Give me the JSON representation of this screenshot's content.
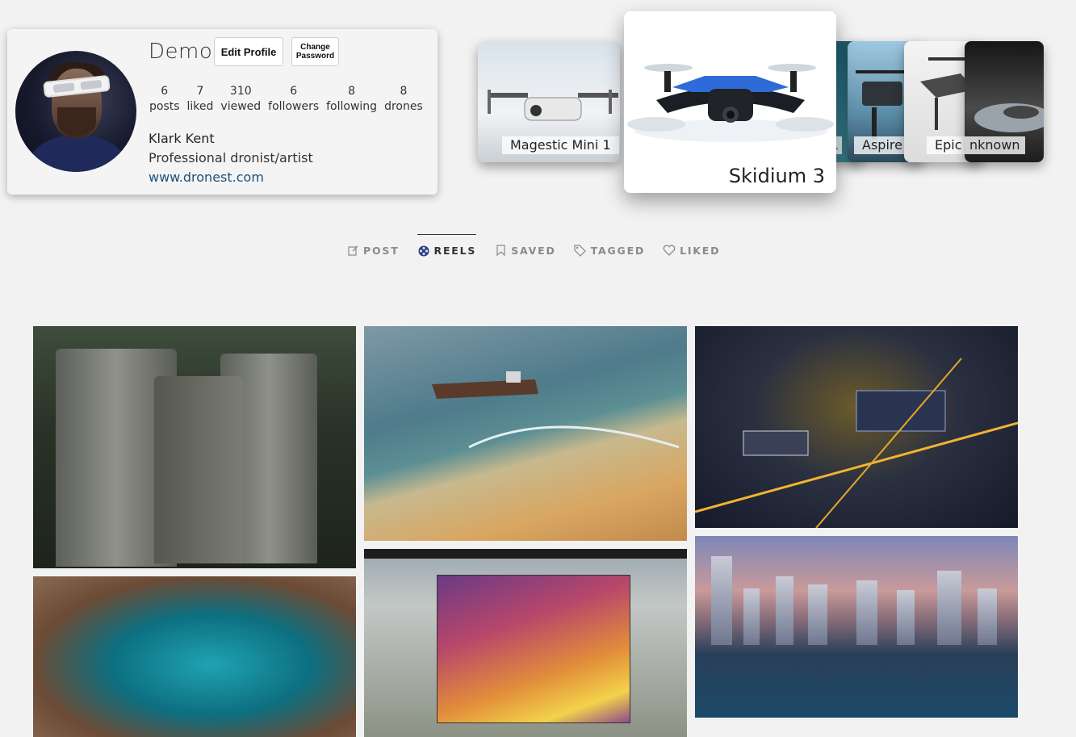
{
  "profile": {
    "username": "Demo",
    "edit_profile_label": "Edit Profile",
    "change_password_label": "Change\nPassword",
    "real_name": "Klark Kent",
    "bio": "Professional dronist/artist",
    "website": "www.dronest.com",
    "stats": [
      {
        "value": "6",
        "label": "posts"
      },
      {
        "value": "7",
        "label": "liked"
      },
      {
        "value": "310",
        "label": "viewed"
      },
      {
        "value": "6",
        "label": "followers"
      },
      {
        "value": "8",
        "label": "following"
      },
      {
        "value": "8",
        "label": "drones"
      }
    ]
  },
  "drones": {
    "featured": "Skidium 3",
    "cards": [
      {
        "label": "Magestic Mini 1"
      },
      {
        "label": "e 1"
      },
      {
        "label": "Aspire 2"
      },
      {
        "label": "Epic 2"
      },
      {
        "label": "nknown"
      }
    ]
  },
  "tabs": [
    {
      "label": "POST",
      "icon": "edit-icon"
    },
    {
      "label": "REELS",
      "icon": "film-reel-icon",
      "active": true
    },
    {
      "label": "SAVED",
      "icon": "bookmark-icon"
    },
    {
      "label": "TAGGED",
      "icon": "tag-icon"
    },
    {
      "label": "LIKED",
      "icon": "heart-icon"
    }
  ],
  "colors": {
    "background": "#f2f2f2",
    "link": "#1d4f7a",
    "active_tab": "#333333",
    "inactive_tab": "#8a8a8a"
  }
}
